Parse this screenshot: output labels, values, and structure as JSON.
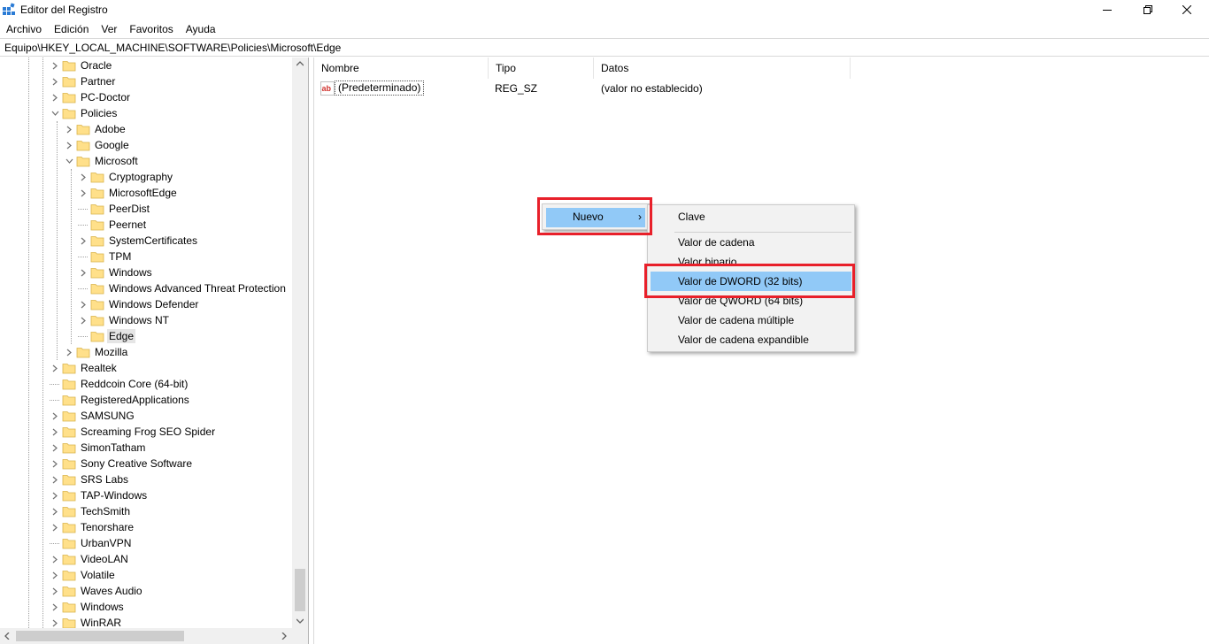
{
  "window": {
    "title": "Editor del Registro"
  },
  "menu": [
    "Archivo",
    "Edición",
    "Ver",
    "Favoritos",
    "Ayuda"
  ],
  "address": "Equipo\\HKEY_LOCAL_MACHINE\\SOFTWARE\\Policies\\Microsoft\\Edge",
  "tree": {
    "items": [
      {
        "label": "Oracle",
        "expander": "collapsed"
      },
      {
        "label": "Partner",
        "expander": "collapsed"
      },
      {
        "label": "PC-Doctor",
        "expander": "collapsed"
      },
      {
        "label": "Policies",
        "expander": "expanded"
      },
      {
        "label": "Adobe",
        "expander": "collapsed"
      },
      {
        "label": "Google",
        "expander": "collapsed"
      },
      {
        "label": "Microsoft",
        "expander": "expanded"
      },
      {
        "label": "Cryptography",
        "expander": "collapsed"
      },
      {
        "label": "MicrosoftEdge",
        "expander": "collapsed"
      },
      {
        "label": "PeerDist",
        "expander": "none"
      },
      {
        "label": "Peernet",
        "expander": "none"
      },
      {
        "label": "SystemCertificates",
        "expander": "collapsed"
      },
      {
        "label": "TPM",
        "expander": "none"
      },
      {
        "label": "Windows",
        "expander": "collapsed"
      },
      {
        "label": "Windows Advanced Threat Protection",
        "expander": "none"
      },
      {
        "label": "Windows Defender",
        "expander": "collapsed"
      },
      {
        "label": "Windows NT",
        "expander": "collapsed"
      },
      {
        "label": "Edge",
        "expander": "none",
        "selected": true
      },
      {
        "label": "Mozilla",
        "expander": "collapsed"
      },
      {
        "label": "Realtek",
        "expander": "collapsed"
      },
      {
        "label": "Reddcoin Core (64-bit)",
        "expander": "none"
      },
      {
        "label": "RegisteredApplications",
        "expander": "none"
      },
      {
        "label": "SAMSUNG",
        "expander": "collapsed"
      },
      {
        "label": "Screaming Frog SEO Spider",
        "expander": "collapsed"
      },
      {
        "label": "SimonTatham",
        "expander": "collapsed"
      },
      {
        "label": "Sony Creative Software",
        "expander": "collapsed"
      },
      {
        "label": "SRS Labs",
        "expander": "collapsed"
      },
      {
        "label": "TAP-Windows",
        "expander": "collapsed"
      },
      {
        "label": "TechSmith",
        "expander": "collapsed"
      },
      {
        "label": "Tenorshare",
        "expander": "collapsed"
      },
      {
        "label": "UrbanVPN",
        "expander": "none"
      },
      {
        "label": "VideoLAN",
        "expander": "collapsed"
      },
      {
        "label": "Volatile",
        "expander": "collapsed"
      },
      {
        "label": "Waves Audio",
        "expander": "collapsed"
      },
      {
        "label": "Windows",
        "expander": "collapsed"
      },
      {
        "label": "WinRAR",
        "expander": "collapsed"
      }
    ]
  },
  "values": {
    "columns": [
      "Nombre",
      "Tipo",
      "Datos"
    ],
    "rows": [
      {
        "name": "(Predeterminado)",
        "type": "REG_SZ",
        "data": "(valor no establecido)",
        "icon": "string-value-icon"
      }
    ]
  },
  "context_menu": {
    "parent_item": "Nuevo",
    "submenu": [
      "Clave",
      "Valor de cadena",
      "Valor binario",
      "Valor de DWORD (32 bits)",
      "Valor de QWORD (64 bits)",
      "Valor de cadena múltiple",
      "Valor de cadena expandible"
    ],
    "highlighted": "Valor de DWORD (32 bits)"
  },
  "colors": {
    "menu_highlight": "#91c9f7",
    "annotation_red": "#e8202a",
    "folder_yellow": "#ffe08a"
  }
}
